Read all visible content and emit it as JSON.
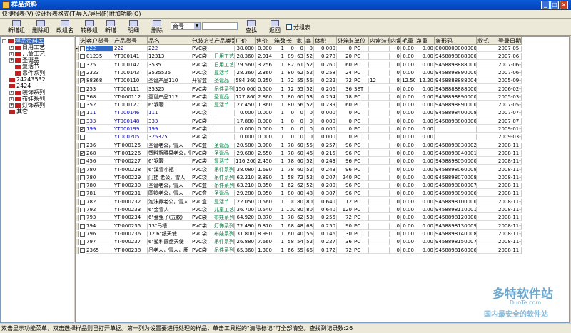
{
  "window": {
    "title": "样品资料"
  },
  "menu": [
    "快捷报表(V)",
    "设计报表格式(T)",
    "导入/导出(F)",
    "附加功能(O)"
  ],
  "toolbar": [
    "新增组",
    "删除组",
    "改组名",
    "转移组",
    "新增",
    "明细",
    "删除",
    "查找",
    "返回"
  ],
  "filter": {
    "field": "商号",
    "value": "",
    "group_label": "分组表"
  },
  "tree": [
    {
      "label": "样品资料库",
      "selected": true,
      "expand": "-"
    },
    {
      "label": "日用工艺",
      "expand": "+"
    },
    {
      "label": "儿童工艺",
      "expand": "+"
    },
    {
      "label": "圣诞品",
      "expand": "+"
    },
    {
      "label": "复活节",
      "expand": ""
    },
    {
      "label": "吊件系列",
      "expand": ""
    },
    {
      "label": "24243532",
      "expand": ""
    },
    {
      "label": "2424",
      "expand": ""
    },
    {
      "label": "装饰系列",
      "expand": "+"
    },
    {
      "label": "布娃系列",
      "expand": "+"
    },
    {
      "label": "灯饰系列",
      "expand": "+"
    },
    {
      "label": "其它",
      "expand": ""
    }
  ],
  "columns": [
    "选",
    "客户货号",
    "产品货号",
    "品名",
    "包装方式",
    "产品类别",
    "厂价",
    "售价",
    "箱数",
    "长",
    "宽",
    "高",
    "体积",
    "外箱装量",
    "单位",
    "内盒装量",
    "内盒个数",
    "毛重",
    "净重",
    "条形码",
    "款式",
    "登录日期"
  ],
  "rows": [
    [
      "",
      "222",
      "222",
      "222",
      "PVC袋",
      "",
      "38.000",
      "0.000",
      "1",
      "0",
      "0",
      "0",
      "0.000",
      "0",
      "PC",
      "",
      "0",
      "0.00",
      "0.00",
      "0000000000000",
      "",
      "2007-05-17"
    ],
    [
      "",
      "01235",
      "YT000141",
      "12313",
      "PVC袋",
      "日用工艺",
      "28.360",
      "2.014",
      "1",
      "89",
      "63",
      "52",
      "0.278",
      "20",
      "PC",
      "",
      "0",
      "0.00",
      "0.00",
      "9458898888000",
      "",
      "2007-06-09"
    ],
    [
      "",
      "325",
      "YT000142",
      "3535",
      "PVC袋",
      "日用工艺",
      "79.560",
      "3.256",
      "1",
      "82",
      "61",
      "52",
      "0.260",
      "60",
      "PC",
      "",
      "0",
      "0.00",
      "0.00",
      "9458898888000",
      "",
      "2007-06-13"
    ],
    [
      "✓",
      "2323",
      "YT000143",
      "3535535",
      "PVC袋",
      "复活节",
      "28.360",
      "2.360",
      "1",
      "80",
      "62",
      "52",
      "0.258",
      "24",
      "PC",
      "",
      "0",
      "0.00",
      "0.00",
      "9458898890000",
      "",
      "2007-06-13"
    ],
    [
      "✓",
      "88368",
      "YT000110",
      "圣诞产品110",
      "开窗盒",
      "圣诞品",
      "584.360",
      "0.250",
      "1",
      "72",
      "55",
      "56",
      "0.222",
      "72",
      "PC",
      "12",
      "8",
      "12.50",
      "12.20",
      "9458888888004",
      "",
      "2005-09-08"
    ],
    [
      "",
      "253",
      "YT000111",
      "35325",
      "PVC袋",
      "吊件系列",
      "150.000",
      "0.500",
      "1",
      "72",
      "55",
      "52",
      "0.206",
      "36",
      "SET",
      "",
      "0",
      "0.00",
      "0.00",
      "9458888888000",
      "",
      "2006-02-08"
    ],
    [
      "",
      "368",
      "YT-000112",
      "圣诞产品112",
      "PVC袋",
      "圣诞品",
      "127.860",
      "2.860",
      "1",
      "80",
      "60",
      "53",
      "0.254",
      "78",
      "PC",
      "",
      "0",
      "0.00",
      "0.00",
      "9458898890000",
      "",
      "2005-03-01"
    ],
    [
      "",
      "352",
      "YT000127",
      "6\"钢鞭",
      "PVC袋",
      "复活节",
      "27.450",
      "1.860",
      "1",
      "80",
      "56",
      "52",
      "0.239",
      "60",
      "PC",
      "",
      "0",
      "0.00",
      "0.00",
      "9458898890000",
      "",
      "2007-05-30"
    ],
    [
      "✓",
      "111",
      "YT000146",
      "111",
      "PVC袋",
      "",
      "0.000",
      "0.000",
      "1",
      "0",
      "0",
      "0",
      "0.000",
      "0",
      "PC",
      "",
      "0",
      "0.00",
      "0.00",
      "9458898400008",
      "",
      "2007-07-17"
    ],
    [
      "",
      "333",
      "YT000148",
      "333",
      "PVC袋",
      "",
      "17.880",
      "0.000",
      "1",
      "0",
      "0",
      "0",
      "0.000",
      "0",
      "PC",
      "",
      "0",
      "0.00",
      "0.00",
      "9458898800000",
      "",
      "2007-07-17"
    ],
    [
      "✓",
      "199",
      "YT000199",
      "199",
      "PVC袋",
      "",
      "0.000",
      "0.000",
      "1",
      "0",
      "0",
      "0",
      "0.000",
      "0",
      "PC",
      "",
      "0",
      "0.00",
      "0.00",
      "",
      "",
      "2009-01-05"
    ],
    [
      "",
      "",
      "YT000205",
      "325325",
      "PVC袋",
      "",
      "0.000",
      "0.000",
      "1",
      "0",
      "0",
      "0",
      "0.000",
      "0",
      "PC",
      "",
      "0",
      "0.00",
      "0.00",
      "",
      "",
      "2009-03-18"
    ],
    [
      "",
      "236",
      "YT-000125",
      "圣诞老公，雪人",
      "PVC盒",
      "圣诞品",
      "20.580",
      "3.980",
      "1",
      "78",
      "60",
      "55",
      "0.257",
      "96",
      "PC",
      "",
      "0",
      "0.00",
      "0.00",
      "9458898030002",
      "",
      "2008-11-22"
    ],
    [
      "✓",
      "268",
      "YT-001226",
      "塑料瓶腰果老公，雪",
      "PVC袋",
      "圣诞品",
      "29.680",
      "2.650",
      "1",
      "78",
      "60",
      "46",
      "0.215",
      "96",
      "PC",
      "",
      "0",
      "0.00",
      "0.00",
      "9458898040001",
      "",
      "2008-11-22"
    ],
    [
      "",
      "456",
      "YT-000227",
      "6\"钢鞭",
      "PVC袋",
      "复活节",
      "116.200",
      "2.450",
      "1",
      "78",
      "60",
      "52",
      "0.243",
      "96",
      "PC",
      "",
      "0",
      "0.00",
      "0.00",
      "9458898050000",
      "",
      "2008-11-22"
    ],
    [
      "✓",
      "780",
      "YT-000228",
      "6\"溪雪小瓶",
      "PVC袋",
      "吊件系列",
      "38.080",
      "1.690",
      "1",
      "78",
      "60",
      "52",
      "0.243",
      "96",
      "PC",
      "",
      "0",
      "0.00",
      "0.00",
      "9458898060009",
      "",
      "2008-11-22"
    ],
    [
      "",
      "780",
      "YT-000229",
      "门挂 老公，雪人",
      "PVC袋",
      "吊件系列",
      "62.210",
      "3.890",
      "1",
      "58",
      "72",
      "52",
      "0.207",
      "240",
      "PC",
      "",
      "0",
      "0.00",
      "0.00",
      "9458898070008",
      "",
      "2008-11-22"
    ],
    [
      "",
      "780",
      "YT-000230",
      "圣诞老公，雪人",
      "PVC盒",
      "吊件系列",
      "63.210",
      "0.350",
      "1",
      "62",
      "62",
      "52",
      "0.200",
      "96",
      "PC",
      "",
      "0",
      "0.00",
      "0.00",
      "9458898080007",
      "",
      "2008-11-22"
    ],
    [
      "",
      "781",
      "YT-000231",
      "圆铃老公，雪人",
      "PVC盒",
      "圣诞品",
      "29.280",
      "0.050",
      "1",
      "80",
      "80",
      "48",
      "0.307",
      "96",
      "PC",
      "",
      "0",
      "0.00",
      "0.00",
      "9458898090006",
      "",
      "2008-11-22"
    ],
    [
      "",
      "782",
      "YT-000232",
      "泡沫鼻老公，雪人",
      "PVC盒",
      "复活节",
      "22.050",
      "0.560",
      "1",
      "100",
      "80",
      "80",
      "0.640",
      "12",
      "PC",
      "",
      "0",
      "0.00",
      "0.00",
      "9458898100000",
      "",
      "2008-11-22"
    ],
    [
      "",
      "792",
      "YT-000233",
      "6\"金雪人",
      "PVC袋",
      "儿童工艺",
      "36.700",
      "0.540",
      "1",
      "100",
      "80",
      "80",
      "0.640",
      "120",
      "PC",
      "",
      "0",
      "0.00",
      "0.00",
      "9458898110001",
      "",
      "2008-11-22"
    ],
    [
      "",
      "793",
      "YT-000234",
      "6\"金兔子(五款)",
      "PVC袋",
      "布娃系列",
      "64.920",
      "0.870",
      "1",
      "78",
      "62",
      "53",
      "0.256",
      "72",
      "PC",
      "",
      "0",
      "0.00",
      "0.00",
      "9458898120000",
      "",
      "2008-11-22"
    ],
    [
      "",
      "794",
      "YT-000235",
      "13\"马槽",
      "PVC袋",
      "灯饰系列",
      "72.490",
      "6.870",
      "1",
      "68",
      "48",
      "68",
      "0.250",
      "90",
      "PC",
      "",
      "0",
      "0.00",
      "0.00",
      "9458898130009",
      "",
      "2008-11-22"
    ],
    [
      "",
      "796",
      "YT-000236",
      "12.6\"纸天使",
      "PVC袋",
      "布娃系列",
      "31.800",
      "8.990",
      "1",
      "60",
      "40",
      "56",
      "0.146",
      "30",
      "PC",
      "",
      "0",
      "0.00",
      "0.00",
      "9458898140008",
      "",
      "2008-11-22"
    ],
    [
      "",
      "797",
      "YT-000237",
      "6\"塑料圆盘天使",
      "PVC袋",
      "吊件系列",
      "26.880",
      "7.660",
      "1",
      "58",
      "54",
      "52",
      "0.227",
      "36",
      "PC",
      "",
      "0",
      "0.00",
      "0.00",
      "9458898150007",
      "",
      "2008-11-22"
    ],
    [
      "",
      "2365",
      "YT-000238",
      "吊老人，雪人，鹿",
      "PVC袋",
      "吊件系列",
      "65.360",
      "1.300",
      "1",
      "66",
      "55",
      "66",
      "0.172",
      "72",
      "PC",
      "",
      "0",
      "0.00",
      "0.00",
      "9458898160006",
      "",
      "2008-11-22"
    ]
  ],
  "status": "双击显示功能菜单，双击选择样品则已打开单据。第一列为设置要进行处理的样品，单击工具栏的\"清除标记\"可全部清空。查找到记录数:26",
  "watermark": {
    "brand": "多特软件站",
    "domain": "DuoTe.com",
    "slogan": "国内最安全的软件站"
  },
  "colors": {
    "titlebar": "#0a5bd8",
    "selected_row": "#316ac5",
    "link_text": "#0000c0",
    "category_green": "#008040"
  }
}
